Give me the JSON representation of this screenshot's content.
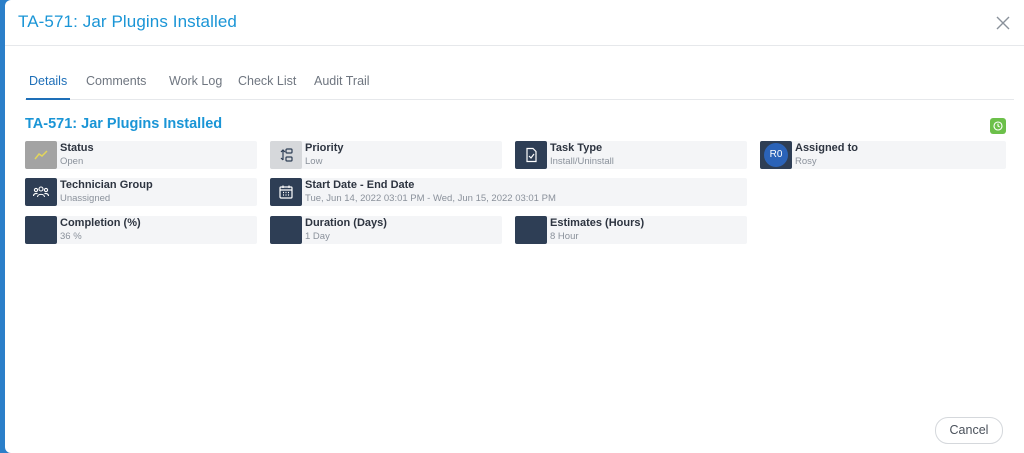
{
  "modal": {
    "title": "TA-571: Jar Plugins Installed",
    "close_icon": "close-icon"
  },
  "tabs": [
    {
      "label": "Details",
      "active": true
    },
    {
      "label": "Comments",
      "active": false
    },
    {
      "label": "Work Log",
      "active": false
    },
    {
      "label": "Check List",
      "active": false
    },
    {
      "label": "Audit Trail",
      "active": false
    }
  ],
  "details": {
    "title": "TA-571: Jar Plugins Installed",
    "timer_icon": "clock-icon",
    "colors": {
      "accent": "#1a95d6",
      "timer": "#6cc04a",
      "icon_bg": "#2e3e55"
    },
    "fields": {
      "status": {
        "label": "Status",
        "value": "Open",
        "icon": "trend-line-icon"
      },
      "priority": {
        "label": "Priority",
        "value": "Low",
        "icon": "priority-icon"
      },
      "task_type": {
        "label": "Task Type",
        "value": "Install/Uninstall",
        "icon": "document-check-icon"
      },
      "assigned_to": {
        "label": "Assigned to",
        "value": "Rosy",
        "avatar_initials": "R0"
      },
      "technician_group": {
        "label": "Technician Group",
        "value": "Unassigned",
        "icon": "group-icon"
      },
      "date_range": {
        "label": "Start Date - End Date",
        "value": "Tue, Jun 14, 2022 03:01 PM - Wed, Jun 15, 2022 03:01 PM",
        "icon": "calendar-icon"
      },
      "completion": {
        "label": "Completion (%)",
        "value": "36 %"
      },
      "duration": {
        "label": "Duration (Days)",
        "value": "1 Day"
      },
      "estimates": {
        "label": "Estimates (Hours)",
        "value": "8 Hour"
      }
    }
  },
  "footer": {
    "cancel_label": "Cancel"
  }
}
